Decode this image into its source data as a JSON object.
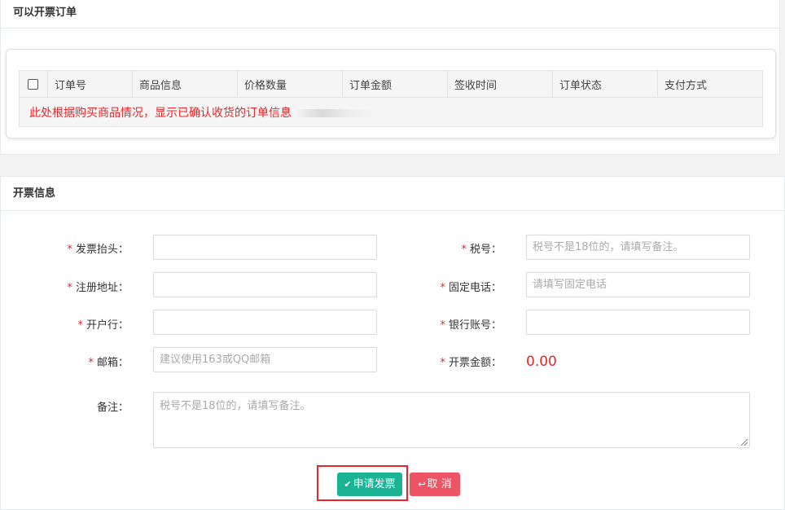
{
  "orders_panel": {
    "title": "可以开票订单",
    "columns": [
      "订单号",
      "商品信息",
      "价格数量",
      "订单金额",
      "签收时间",
      "订单状态",
      "支付方式"
    ],
    "notice": "此处根据购买商品情况，显示已确认收货的订单信息"
  },
  "invoice_panel": {
    "title": "开票信息",
    "fields": {
      "invoice_title": {
        "label": "发票抬头：",
        "value": "",
        "placeholder": ""
      },
      "tax_no": {
        "label": "税号：",
        "value": "",
        "placeholder": "税号不是18位的，请填写备注。"
      },
      "reg_address": {
        "label": "注册地址：",
        "value": "",
        "placeholder": ""
      },
      "phone": {
        "label": "固定电话：",
        "value": "",
        "placeholder": "请填写固定电话"
      },
      "bank": {
        "label": "开户行：",
        "value": "",
        "placeholder": ""
      },
      "bank_account": {
        "label": "银行账号：",
        "value": "",
        "placeholder": ""
      },
      "email": {
        "label": "邮箱：",
        "value": "",
        "placeholder": "建议使用163或QQ邮箱"
      },
      "invoice_amount": {
        "label": "开票金额：",
        "value": "0.00"
      },
      "remark": {
        "label": "备注：",
        "value": "",
        "placeholder": "税号不是18位的，请填写备注。"
      }
    },
    "required_mark": "*",
    "buttons": {
      "apply": {
        "label": "申请发票",
        "icon": "check-icon"
      },
      "cancel": {
        "label": "取 消",
        "icon": "reply-icon"
      }
    },
    "colors": {
      "apply": "#1ab394",
      "cancel": "#ed5565",
      "highlight": "#e8262a"
    }
  }
}
